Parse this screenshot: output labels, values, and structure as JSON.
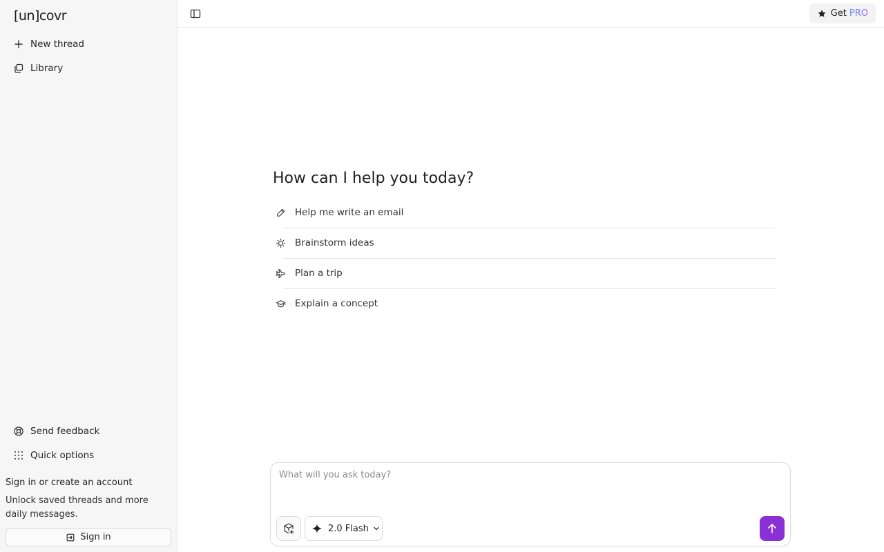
{
  "app": {
    "logo_bracket": "[un]",
    "logo_text": "covr"
  },
  "sidebar": {
    "items": [
      {
        "label": "New thread",
        "icon": "plus-icon"
      },
      {
        "label": "Library",
        "icon": "library-icon"
      }
    ],
    "footer_items": [
      {
        "label": "Send feedback",
        "icon": "lifebuoy-icon"
      },
      {
        "label": "Quick options",
        "icon": "grid-dots-icon"
      }
    ],
    "signin": {
      "title": "Sign in or create an account",
      "description": "Unlock saved threads and more daily messages.",
      "button_label": "Sign in"
    }
  },
  "topbar": {
    "getpro_prefix": "Get",
    "getpro_badge": "PRO"
  },
  "main": {
    "headline": "How can I help you today?",
    "suggestions": [
      {
        "label": "Help me write an email",
        "icon": "pencil-icon"
      },
      {
        "label": "Brainstorm ideas",
        "icon": "lightbulb-icon"
      },
      {
        "label": "Plan a trip",
        "icon": "plane-icon"
      },
      {
        "label": "Explain a concept",
        "icon": "graduation-cap-icon"
      }
    ]
  },
  "composer": {
    "placeholder": "What will you ask today?",
    "model_label": "2.0 Flash"
  },
  "colors": {
    "accent": "#8b2fd6",
    "sidebar_bg": "#f6f6f6"
  }
}
